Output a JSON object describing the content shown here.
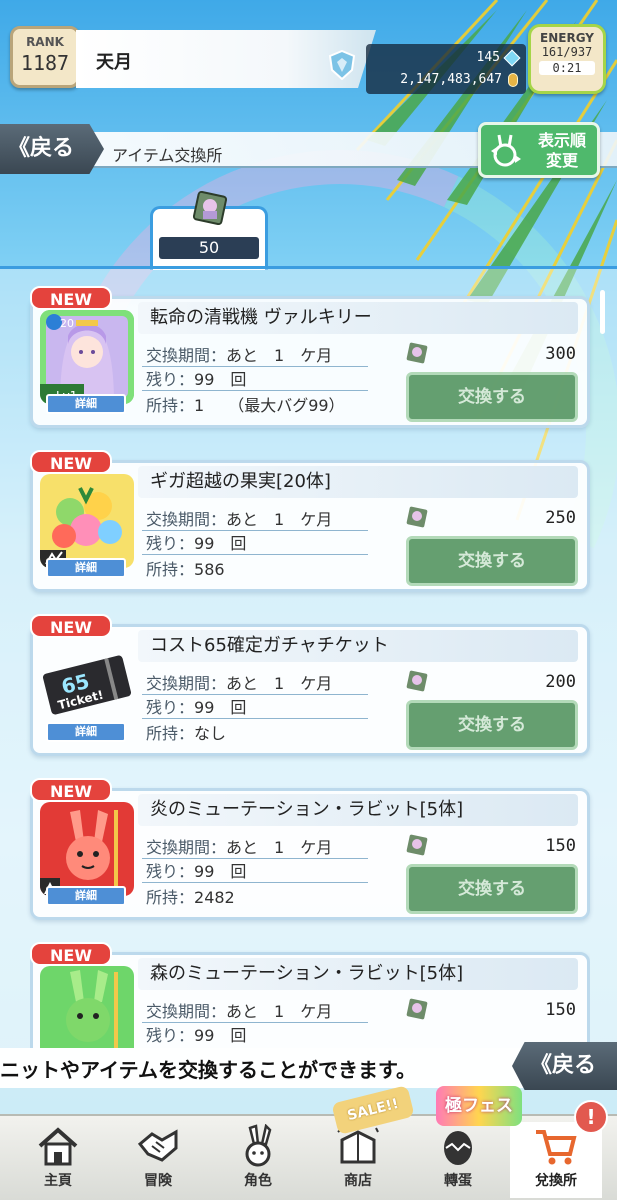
{
  "player": {
    "rank_label": "RANK",
    "rank_value": "1187",
    "name": "天月",
    "gems": "145",
    "coins": "2,147,483,647",
    "energy_label": "ENERGY",
    "energy_value": "161/937",
    "energy_timer": "0:21"
  },
  "header": {
    "back_label": "《戻る",
    "title": "アイテム交換所",
    "sort_label_1": "表示順",
    "sort_label_2": "変更"
  },
  "tab": {
    "ticket_count": "50"
  },
  "items": [
    {
      "badge": "NEW",
      "name": "転命の清戦機 ヴァルキリー",
      "period_label": "交換期間：",
      "period_value": "あと　1　ケ月",
      "remaining_label": "残り：",
      "remaining_value": "99　回",
      "owned_label": "所持：",
      "owned_value": "1　　（最大バグ99）",
      "detail_label": "詳細",
      "cost": "300",
      "exchange_label": "交換する",
      "thumb_icon": "valkyrie-character-icon",
      "level_text": "Lv1",
      "star_text": "20"
    },
    {
      "badge": "NEW",
      "name": "ギガ超越の果実[20体]",
      "period_label": "交換期間：",
      "period_value": "あと　1　ケ月",
      "remaining_label": "残り：",
      "remaining_value": "99　回",
      "owned_label": "所持：",
      "owned_value": "586",
      "detail_label": "詳細",
      "cost": "250",
      "exchange_label": "交換する",
      "thumb_icon": "giga-fruit-icon"
    },
    {
      "badge": "NEW",
      "name": "コスト65確定ガチャチケット",
      "period_label": "交換期間：",
      "period_value": "あと　1　ケ月",
      "remaining_label": "残り：",
      "remaining_value": "99　回",
      "owned_label": "所持：",
      "owned_value": "なし",
      "detail_label": "詳細",
      "cost": "200",
      "exchange_label": "交換する",
      "thumb_icon": "gacha-ticket-icon",
      "ticket_num": "65",
      "ticket_word": "Ticket!"
    },
    {
      "badge": "NEW",
      "name": "炎のミューテーション・ラビット[5体]",
      "period_label": "交換期間：",
      "period_value": "あと　1　ケ月",
      "remaining_label": "残り：",
      "remaining_value": "99　回",
      "owned_label": "所持：",
      "owned_value": "2482",
      "detail_label": "詳細",
      "cost": "150",
      "exchange_label": "交換する",
      "thumb_icon": "fire-rabbit-icon"
    },
    {
      "badge": "NEW",
      "name": "森のミューテーション・ラビット[5体]",
      "period_label": "交換期間：",
      "period_value": "あと　1　ケ月",
      "remaining_label": "残り：",
      "remaining_value": "99　回",
      "cost": "150",
      "thumb_icon": "forest-rabbit-icon"
    }
  ],
  "marquee": {
    "text": "ニットやアイテムを交換することができます。",
    "back_label": "《戻る"
  },
  "promos": {
    "sale": "SALE!!",
    "fes": "極フェス",
    "alert": "!"
  },
  "nav": [
    {
      "label": "主頁",
      "icon": "home-icon"
    },
    {
      "label": "冒険",
      "icon": "handshake-icon"
    },
    {
      "label": "角色",
      "icon": "rabbit-icon"
    },
    {
      "label": "商店",
      "icon": "shop-icon"
    },
    {
      "label": "轉蛋",
      "icon": "egg-icon"
    },
    {
      "label": "兌換所",
      "icon": "cart-icon"
    }
  ],
  "colors": {
    "new_badge": "#e4433d",
    "exchange_button": "#4b8f58",
    "detail_button": "#4e8fd6",
    "tab_border": "#3b9de0"
  }
}
